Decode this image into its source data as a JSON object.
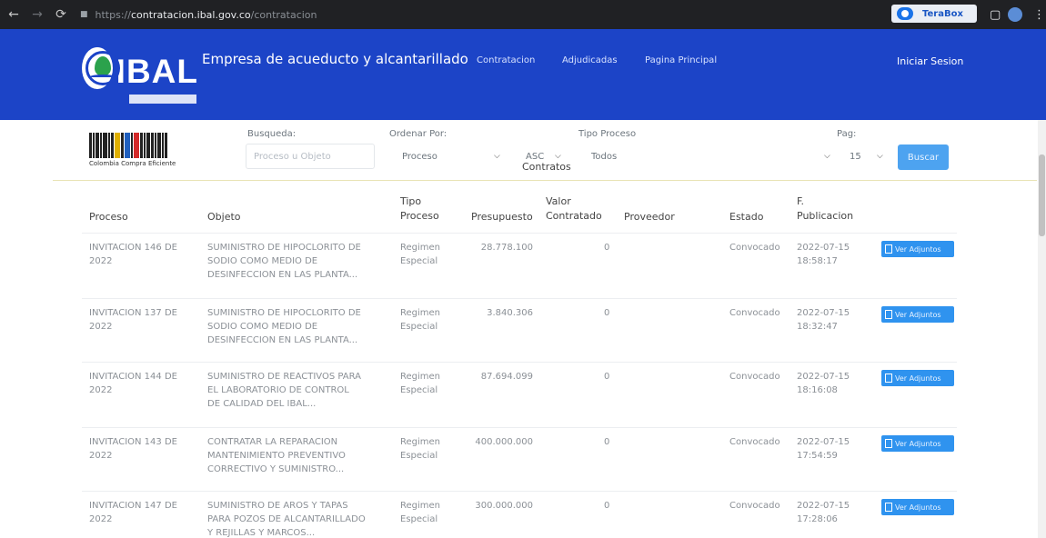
{
  "browser": {
    "url_proto": "https://",
    "url_host": "contratacion.ibal.gov.co",
    "url_path": "/contratacion",
    "extension_label": "TeraBox"
  },
  "header": {
    "logo_text": "IBAL",
    "brand_title": "Empresa de acueducto y alcantarillado",
    "nav": [
      "Contratacion",
      "Adjudicadas",
      "Pagina Principal"
    ],
    "login": "Iniciar Sesion",
    "bg_color": "#1c44c7"
  },
  "filters": {
    "cce_logo_text": "Colombia Compra Eficiente",
    "search_label": "Busqueda:",
    "search_placeholder": "Proceso u Objeto",
    "order_label": "Ordenar Por:",
    "order_value": "Proceso",
    "direction_value": "ASC",
    "type_label": "Tipo Proceso",
    "type_value": "Todos",
    "page_label": "Pag:",
    "page_value": "15",
    "search_button": "Buscar"
  },
  "table": {
    "title": "Contratos",
    "headers": {
      "proceso": "Proceso",
      "objeto": "Objeto",
      "tipo_1": "Tipo",
      "tipo_2": "Proceso",
      "presupuesto": "Presupuesto",
      "valor_1": "Valor",
      "valor_2": "Contratado",
      "proveedor": "Proveedor",
      "estado": "Estado",
      "fecha_1": "F.",
      "fecha_2": "Publicacion"
    },
    "action_label": "Ver Adjuntos",
    "rows": [
      {
        "proceso_1": "INVITACION 146 DE",
        "proceso_2": "2022",
        "objeto_1": "SUMINISTRO DE HIPOCLORITO DE",
        "objeto_2": "SODIO COMO MEDIO DE",
        "objeto_3": "DESINFECCION EN LAS PLANTA...",
        "tipo_1": "Regimen",
        "tipo_2": "Especial",
        "presupuesto": "28.778.100",
        "valor": "0",
        "proveedor": "",
        "estado": "Convocado",
        "fecha_1": "2022-07-15",
        "fecha_2": "18:58:17"
      },
      {
        "proceso_1": "INVITACION 137 DE",
        "proceso_2": "2022",
        "objeto_1": "SUMINISTRO DE HIPOCLORITO DE",
        "objeto_2": "SODIO COMO MEDIO DE",
        "objeto_3": "DESINFECCION EN LAS PLANTA...",
        "tipo_1": "Regimen",
        "tipo_2": "Especial",
        "presupuesto": "3.840.306",
        "valor": "0",
        "proveedor": "",
        "estado": "Convocado",
        "fecha_1": "2022-07-15",
        "fecha_2": "18:32:47"
      },
      {
        "proceso_1": "INVITACION 144 DE",
        "proceso_2": "2022",
        "objeto_1": "SUMINISTRO DE REACTIVOS PARA",
        "objeto_2": "EL LABORATORIO DE CONTROL",
        "objeto_3": "DE CALIDAD DEL IBAL...",
        "tipo_1": "Regimen",
        "tipo_2": "Especial",
        "presupuesto": "87.694.099",
        "valor": "0",
        "proveedor": "",
        "estado": "Convocado",
        "fecha_1": "2022-07-15",
        "fecha_2": "18:16:08"
      },
      {
        "proceso_1": "INVITACION 143 DE",
        "proceso_2": "2022",
        "objeto_1": "CONTRATAR LA REPARACION",
        "objeto_2": "MANTENIMIENTO PREVENTIVO",
        "objeto_3": "CORRECTIVO Y SUMINISTRO...",
        "tipo_1": "Regimen",
        "tipo_2": "Especial",
        "presupuesto": "400.000.000",
        "valor": "0",
        "proveedor": "",
        "estado": "Convocado",
        "fecha_1": "2022-07-15",
        "fecha_2": "17:54:59"
      },
      {
        "proceso_1": "INVITACION 147 DE",
        "proceso_2": "2022",
        "objeto_1": "SUMINISTRO DE AROS Y TAPAS",
        "objeto_2": "PARA POZOS DE ALCANTARILLADO",
        "objeto_3": "Y REJILLAS Y MARCOS...",
        "tipo_1": "Regimen",
        "tipo_2": "Especial",
        "presupuesto": "300.000.000",
        "valor": "0",
        "proveedor": "",
        "estado": "Convocado",
        "fecha_1": "2022-07-15",
        "fecha_2": "17:28:06"
      }
    ]
  }
}
